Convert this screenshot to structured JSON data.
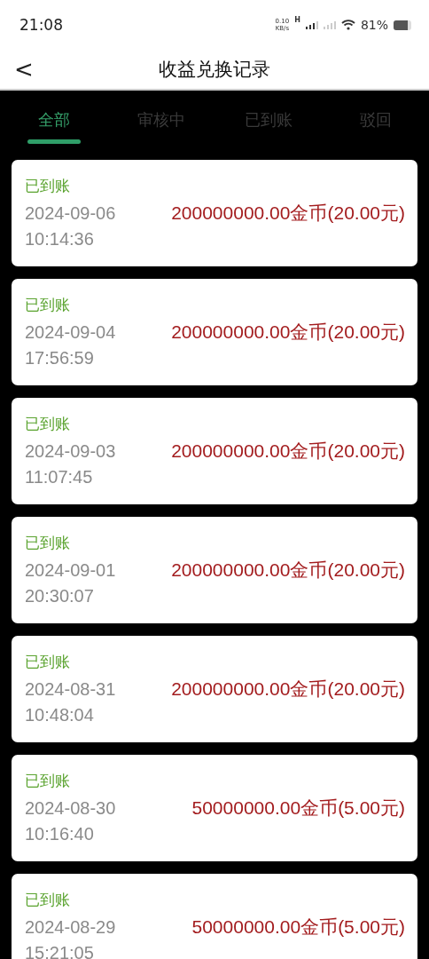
{
  "status_bar": {
    "time": "21:08",
    "speed_value": "0.10",
    "speed_unit": "KB/s",
    "network_type": "H",
    "battery": "81%"
  },
  "header": {
    "back": "<",
    "title": "收益兑换记录"
  },
  "tabs": [
    {
      "label": "全部",
      "selected": true
    },
    {
      "label": "审核中",
      "selected": false
    },
    {
      "label": "已到账",
      "selected": false
    },
    {
      "label": "驳回",
      "selected": false
    }
  ],
  "records": [
    {
      "status": "已到账",
      "date": "2024-09-06",
      "time": "10:14:36",
      "amount": "200000000.00金币(20.00元)"
    },
    {
      "status": "已到账",
      "date": "2024-09-04",
      "time": "17:56:59",
      "amount": "200000000.00金币(20.00元)"
    },
    {
      "status": "已到账",
      "date": "2024-09-03",
      "time": "11:07:45",
      "amount": "200000000.00金币(20.00元)"
    },
    {
      "status": "已到账",
      "date": "2024-09-01",
      "time": "20:30:07",
      "amount": "200000000.00金币(20.00元)"
    },
    {
      "status": "已到账",
      "date": "2024-08-31",
      "time": "10:48:04",
      "amount": "200000000.00金币(20.00元)"
    },
    {
      "status": "已到账",
      "date": "2024-08-30",
      "time": "10:16:40",
      "amount": "50000000.00金币(5.00元)"
    },
    {
      "status": "已到账",
      "date": "2024-08-29",
      "time": "15:21:05",
      "amount": "50000000.00金币(5.00元)"
    }
  ]
}
